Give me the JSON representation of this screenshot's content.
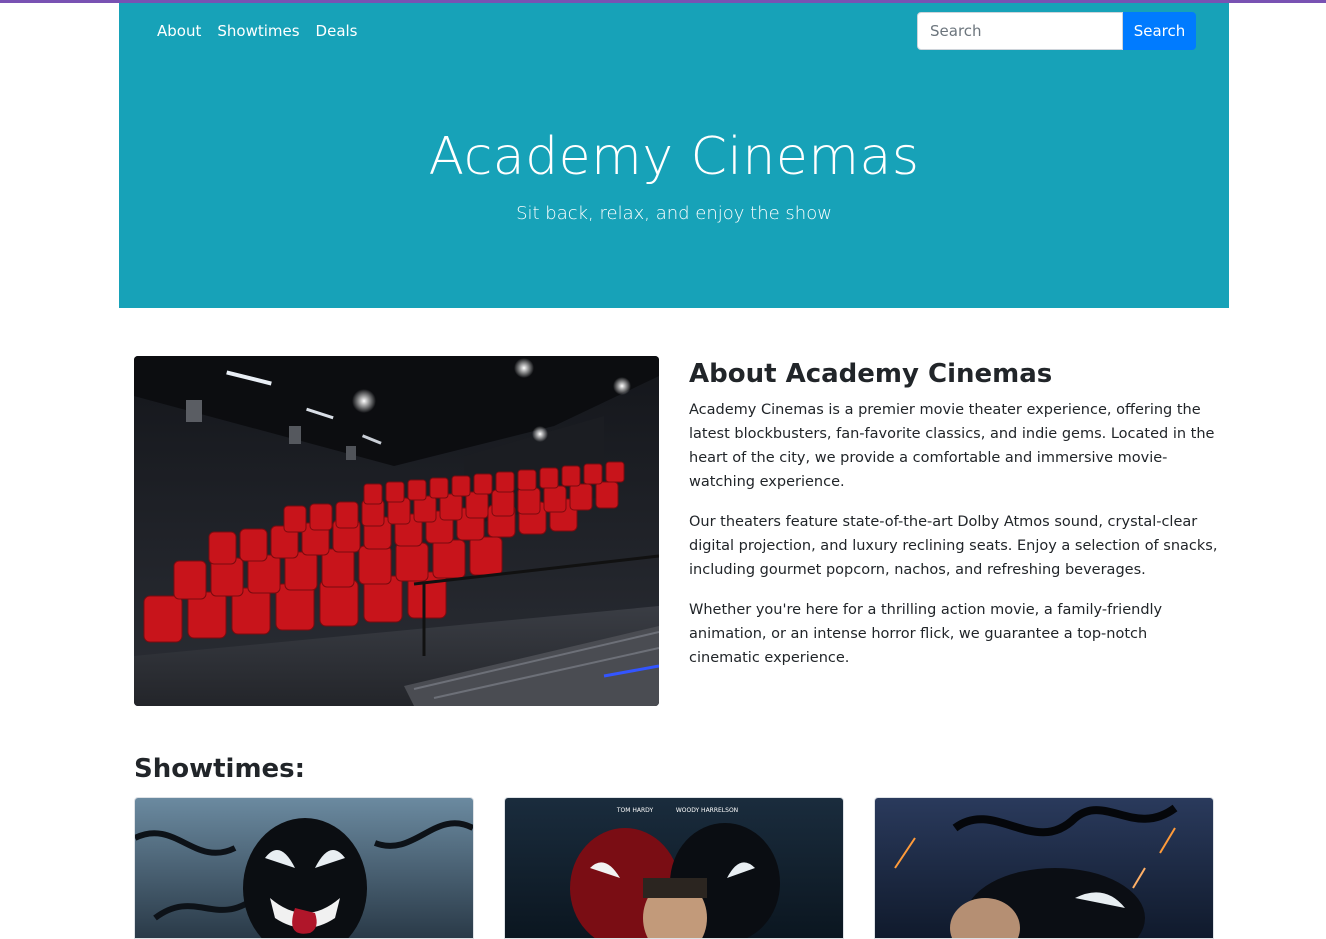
{
  "nav": {
    "links": [
      "About",
      "Showtimes",
      "Deals"
    ],
    "search_placeholder": "Search",
    "search_button": "Search"
  },
  "hero": {
    "title": "Academy Cinemas",
    "subtitle": "Sit back, relax, and enjoy the show"
  },
  "about": {
    "heading": "About Academy Cinemas",
    "paragraphs": [
      "Academy Cinemas is a premier movie theater experience, offering the latest blockbusters, fan-favorite classics, and indie gems. Located in the heart of the city, we provide a comfortable and immersive movie-watching experience.",
      "Our theaters feature state-of-the-art Dolby Atmos sound, crystal-clear digital projection, and luxury reclining seats. Enjoy a selection of snacks, including gourmet popcorn, nachos, and refreshing beverages.",
      "Whether you're here for a thrilling action movie, a family-friendly animation, or an intense horror flick, we guarantee a top-notch cinematic experience."
    ],
    "image_icon": "theater-seats-image"
  },
  "showtimes": {
    "heading": "Showtimes:",
    "poster2_credits": [
      "TOM HARDY",
      "WOODY HARRELSON"
    ]
  },
  "colors": {
    "brand": "#17a2b8",
    "button": "#007bff",
    "accent": "#7952b3"
  }
}
